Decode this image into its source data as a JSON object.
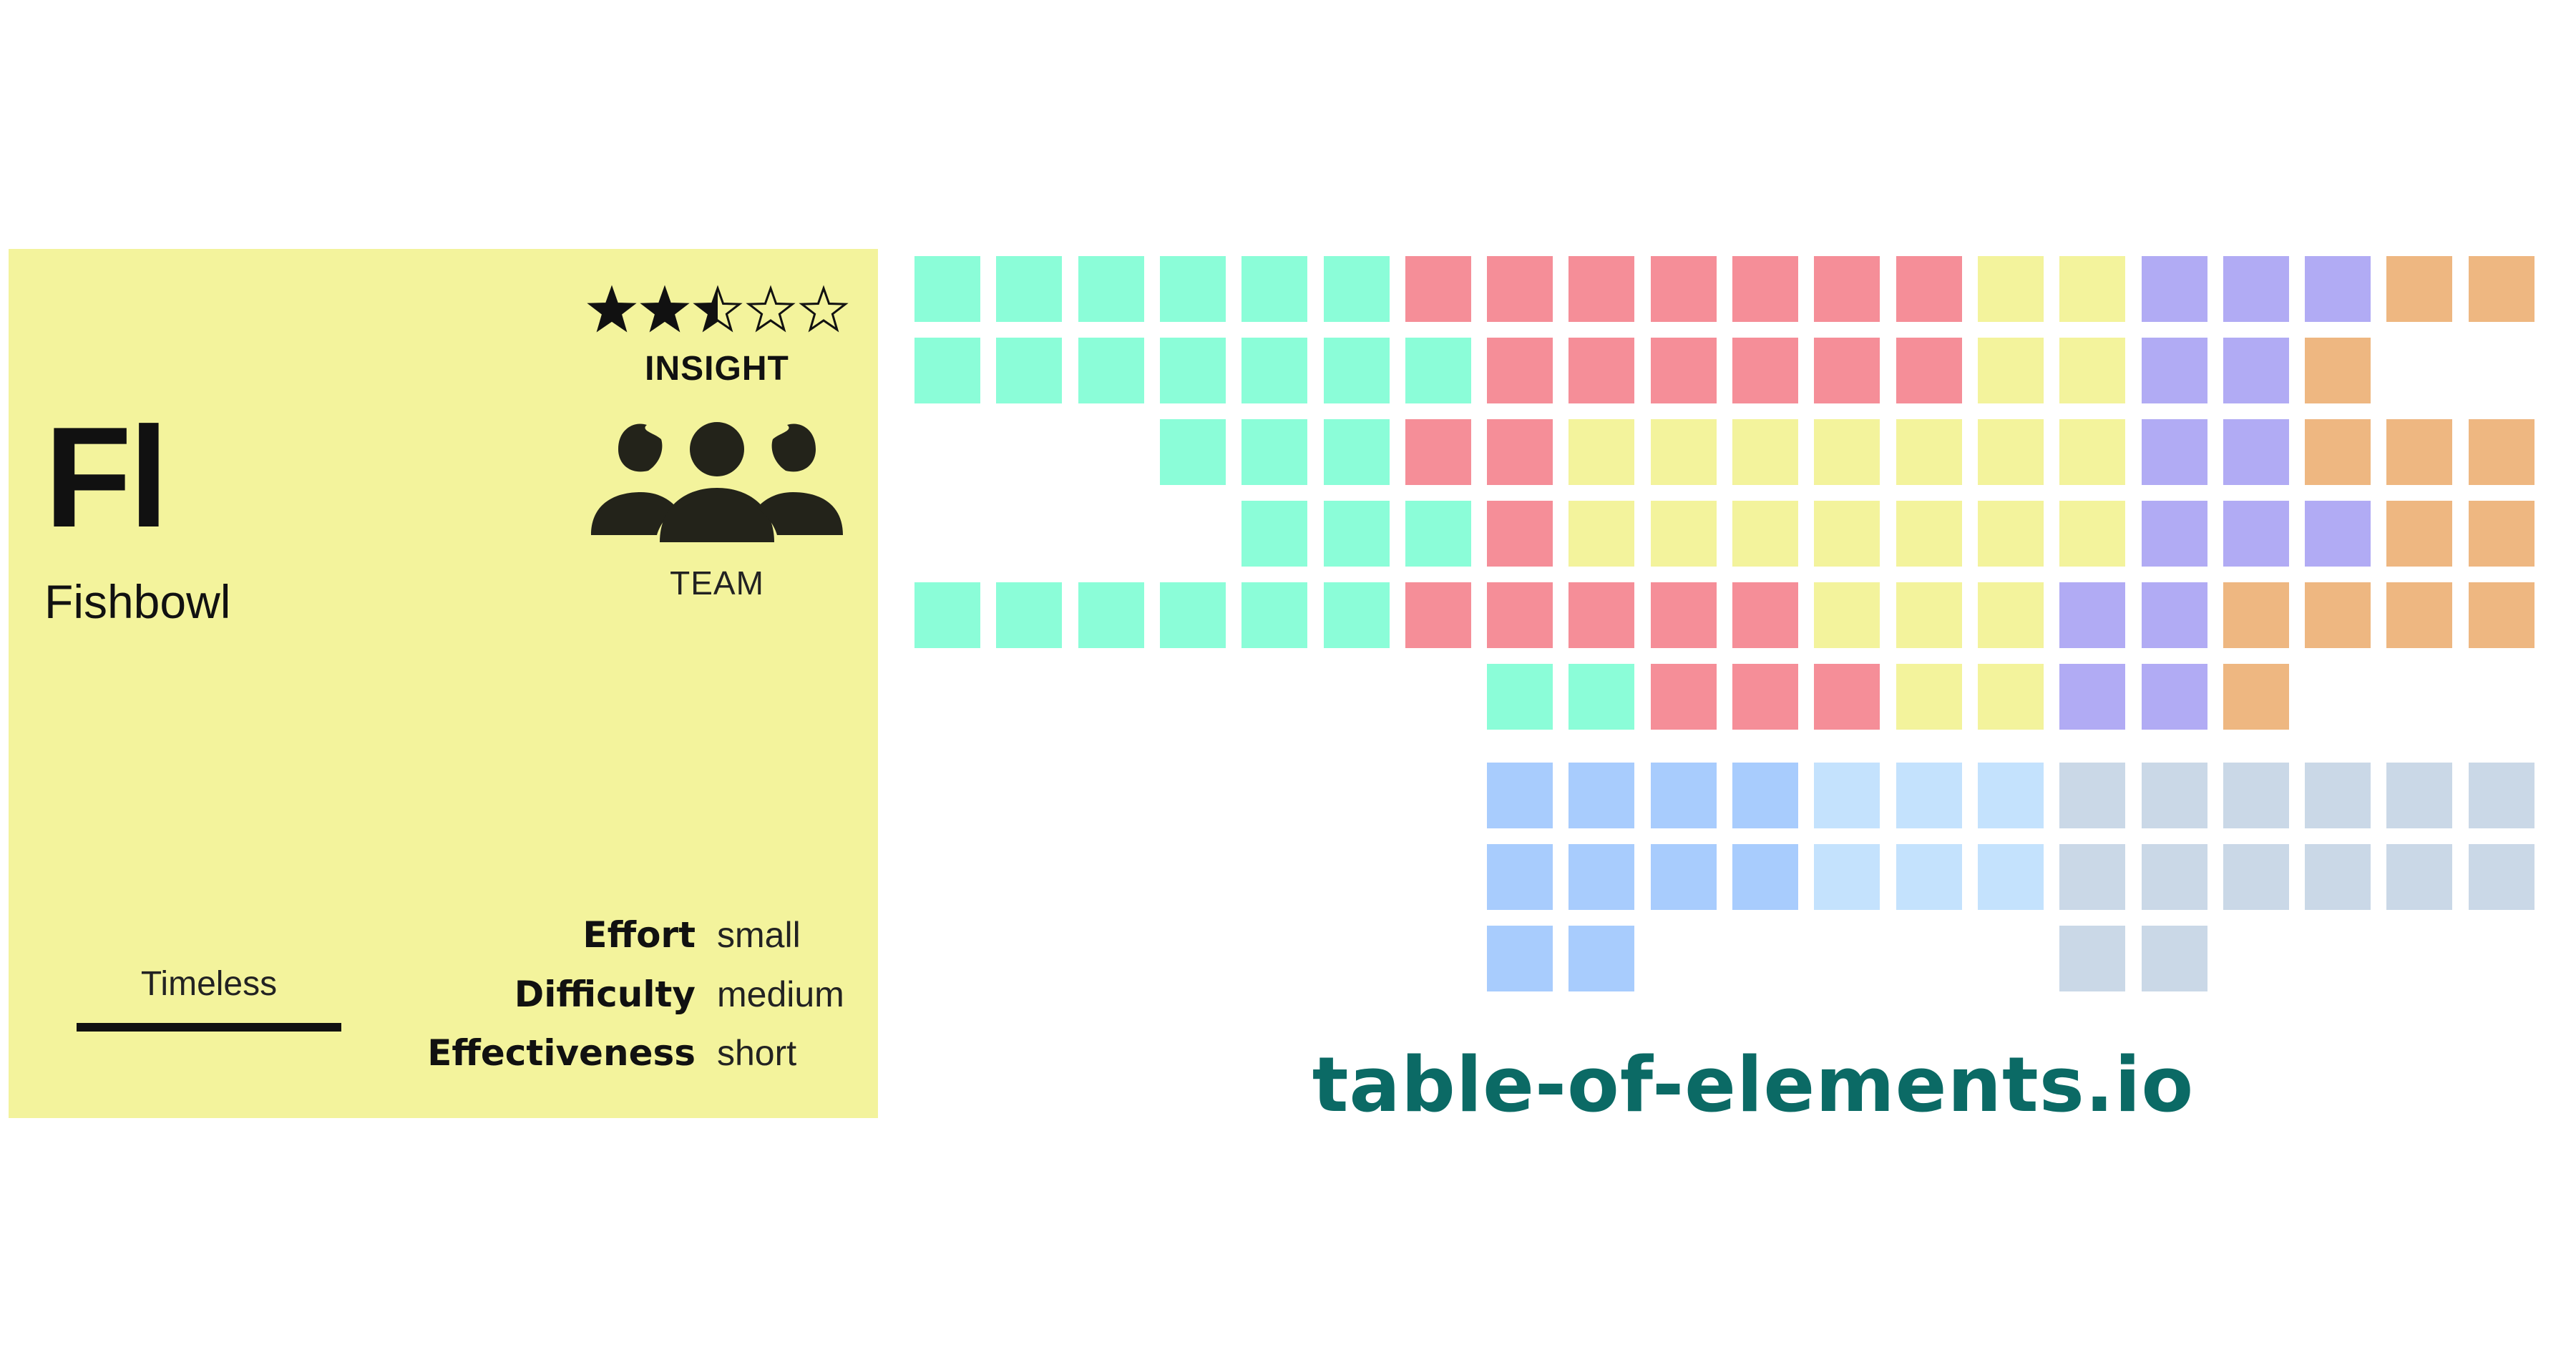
{
  "card": {
    "background": "#f3f39c",
    "symbol": "Fl",
    "name": "Fishbowl",
    "rating": 2.5,
    "rating_max": 5,
    "category": "INSIGHT",
    "icon": "team-icon",
    "scope": "TEAM",
    "timing": "Timeless",
    "metrics": [
      {
        "key": "Effort",
        "value": "small"
      },
      {
        "key": "Difficulty",
        "value": "medium"
      },
      {
        "key": "Effectiveness",
        "value": "short"
      }
    ]
  },
  "site": {
    "url": "table-of-elements.io",
    "color": "#0b6a65"
  },
  "palette": {
    "G": "#8bfdd8",
    "R": "#f58e98",
    "Y": "#f3f39c",
    "P": "#b1abf4",
    "O": "#eeb781",
    "B": "#a8ccfd",
    "L": "#c4e2fd",
    "S": "#cad8e7"
  },
  "element_grid": [
    "GGGGGGRRRRRRRYYPPPOO",
    "GGGGGGGRRRRRRYYPPO..",
    "...GGGRRYYYYYYYPPOOO",
    "....GGGRYYYYYYYPPPOO",
    "GGGGGGRRRRRYYYPPOOOO",
    ".......GGRRRYYPPO...",
    "",
    ".......BBBBLLLSSSSSS",
    ".......BBBBLLLSSSSSS",
    ".......BB.....SS...."
  ]
}
